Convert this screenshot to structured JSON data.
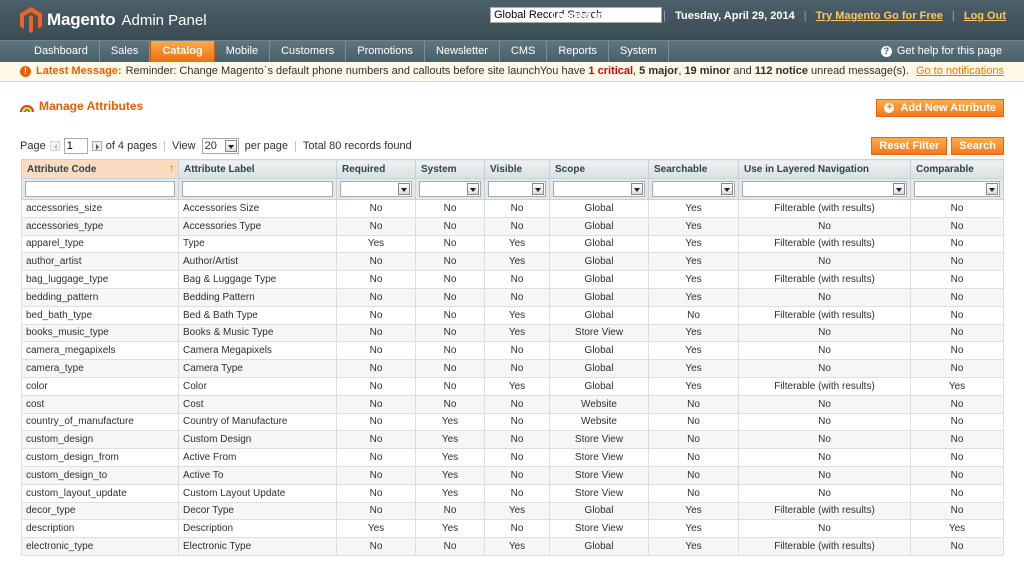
{
  "header": {
    "brand": "Magento",
    "brand_sub": "Admin Panel",
    "search_value": "Global Record Search",
    "logged_in": "Logged in as admin",
    "date": "Tuesday, April 29, 2014",
    "try_link": "Try Magento Go for Free",
    "logout": "Log Out"
  },
  "nav": {
    "items": [
      "Dashboard",
      "Sales",
      "Catalog",
      "Mobile",
      "Customers",
      "Promotions",
      "Newsletter",
      "CMS",
      "Reports",
      "System"
    ],
    "active": "Catalog",
    "help": "Get help for this page"
  },
  "message": {
    "title": "Latest Message:",
    "text": "Reminder: Change Magento`s default phone numbers and callouts before site launch",
    "notice_pre": "You have",
    "critical": "1 critical",
    "major": "5 major",
    "minor": "19 minor",
    "and": "and",
    "notice": "112 notice",
    "notice_post": "unread message(s).",
    "link": "Go to notifications"
  },
  "page": {
    "title": "Manage Attributes",
    "add_button": "Add New Attribute",
    "reset_button": "Reset Filter",
    "search_button": "Search"
  },
  "pager": {
    "page_label": "Page",
    "page_value": "1",
    "of_pages": "of 4 pages",
    "view_label": "View",
    "view_value": "20",
    "per_page": "per page",
    "total": "Total 80 records found"
  },
  "grid": {
    "columns": [
      "Attribute Code",
      "Attribute Label",
      "Required",
      "System",
      "Visible",
      "Scope",
      "Searchable",
      "Use in Layered Navigation",
      "Comparable"
    ],
    "rows": [
      [
        "accessories_size",
        "Accessories Size",
        "No",
        "No",
        "No",
        "Global",
        "Yes",
        "Filterable (with results)",
        "No"
      ],
      [
        "accessories_type",
        "Accessories Type",
        "No",
        "No",
        "No",
        "Global",
        "Yes",
        "No",
        "No"
      ],
      [
        "apparel_type",
        "Type",
        "Yes",
        "No",
        "Yes",
        "Global",
        "Yes",
        "Filterable (with results)",
        "No"
      ],
      [
        "author_artist",
        "Author/Artist",
        "No",
        "No",
        "Yes",
        "Global",
        "Yes",
        "No",
        "No"
      ],
      [
        "bag_luggage_type",
        "Bag & Luggage Type",
        "No",
        "No",
        "No",
        "Global",
        "Yes",
        "Filterable (with results)",
        "No"
      ],
      [
        "bedding_pattern",
        "Bedding Pattern",
        "No",
        "No",
        "No",
        "Global",
        "Yes",
        "No",
        "No"
      ],
      [
        "bed_bath_type",
        "Bed & Bath Type",
        "No",
        "No",
        "Yes",
        "Global",
        "No",
        "Filterable (with results)",
        "No"
      ],
      [
        "books_music_type",
        "Books & Music Type",
        "No",
        "No",
        "Yes",
        "Store View",
        "Yes",
        "No",
        "No"
      ],
      [
        "camera_megapixels",
        "Camera Megapixels",
        "No",
        "No",
        "No",
        "Global",
        "Yes",
        "No",
        "No"
      ],
      [
        "camera_type",
        "Camera Type",
        "No",
        "No",
        "No",
        "Global",
        "Yes",
        "No",
        "No"
      ],
      [
        "color",
        "Color",
        "No",
        "No",
        "Yes",
        "Global",
        "Yes",
        "Filterable (with results)",
        "Yes"
      ],
      [
        "cost",
        "Cost",
        "No",
        "No",
        "No",
        "Website",
        "No",
        "No",
        "No"
      ],
      [
        "country_of_manufacture",
        "Country of Manufacture",
        "No",
        "Yes",
        "No",
        "Website",
        "No",
        "No",
        "No"
      ],
      [
        "custom_design",
        "Custom Design",
        "No",
        "Yes",
        "No",
        "Store View",
        "No",
        "No",
        "No"
      ],
      [
        "custom_design_from",
        "Active From",
        "No",
        "Yes",
        "No",
        "Store View",
        "No",
        "No",
        "No"
      ],
      [
        "custom_design_to",
        "Active To",
        "No",
        "Yes",
        "No",
        "Store View",
        "No",
        "No",
        "No"
      ],
      [
        "custom_layout_update",
        "Custom Layout Update",
        "No",
        "Yes",
        "No",
        "Store View",
        "No",
        "No",
        "No"
      ],
      [
        "decor_type",
        "Decor Type",
        "No",
        "No",
        "Yes",
        "Global",
        "Yes",
        "Filterable (with results)",
        "No"
      ],
      [
        "description",
        "Description",
        "Yes",
        "Yes",
        "No",
        "Store View",
        "Yes",
        "No",
        "Yes"
      ],
      [
        "electronic_type",
        "Electronic Type",
        "No",
        "No",
        "Yes",
        "Global",
        "Yes",
        "Filterable (with results)",
        "No"
      ]
    ]
  },
  "colors": {
    "accent": "#eb5e00",
    "header_bg": "#3a4b53",
    "nav_active": "#f2781d"
  }
}
